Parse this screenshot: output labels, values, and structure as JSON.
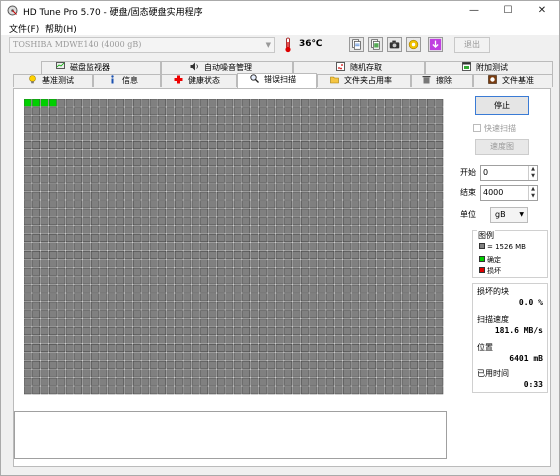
{
  "window": {
    "title": "HD Tune Pro 5.70 - 硬盘/固态硬盘实用程序",
    "minimize": "—",
    "maximize": "☐",
    "close": "✕"
  },
  "menu": [
    "文件(F)",
    "帮助(H)"
  ],
  "toolbar": {
    "drive": "TOSHIBA MDWE140 (4000 gB)",
    "temperature": "36℃",
    "exit_label": "退出"
  },
  "tabs_top": [
    "磁盘监视器",
    "自动噪音管理",
    "随机存取",
    "附加测试"
  ],
  "tabs_bottom": [
    "基准测试",
    "信息",
    "健康状态",
    "错误扫描",
    "文件夹占用率",
    "擦除",
    "文件基准"
  ],
  "active_tab": "错误扫描",
  "controls": {
    "stop_label": "停止",
    "quick_scan_label": "快速扫描",
    "speed_label": "速度图",
    "start_label": "开始",
    "start_value": "0",
    "end_label": "结束",
    "end_value": "4000",
    "unit_label": "单位",
    "unit_value": "gB"
  },
  "legend": {
    "title": "图例",
    "block_size": "= 1526 MB",
    "ok": "确定",
    "damaged": "损坏",
    "colors": {
      "pending": "#808080",
      "ok": "#00d000",
      "damaged": "#e00000"
    }
  },
  "stats": {
    "damaged_label": "损坏的块",
    "damaged_value": "0.0 %",
    "speed_label": "扫描速度",
    "speed_value": "181.6 MB/s",
    "position_label": "位置",
    "position_value": "6401 mB",
    "elapsed_label": "已用时间",
    "elapsed_value": "0:33"
  },
  "scan": {
    "columns": 50,
    "rows": 35,
    "completed_blocks": 4
  }
}
